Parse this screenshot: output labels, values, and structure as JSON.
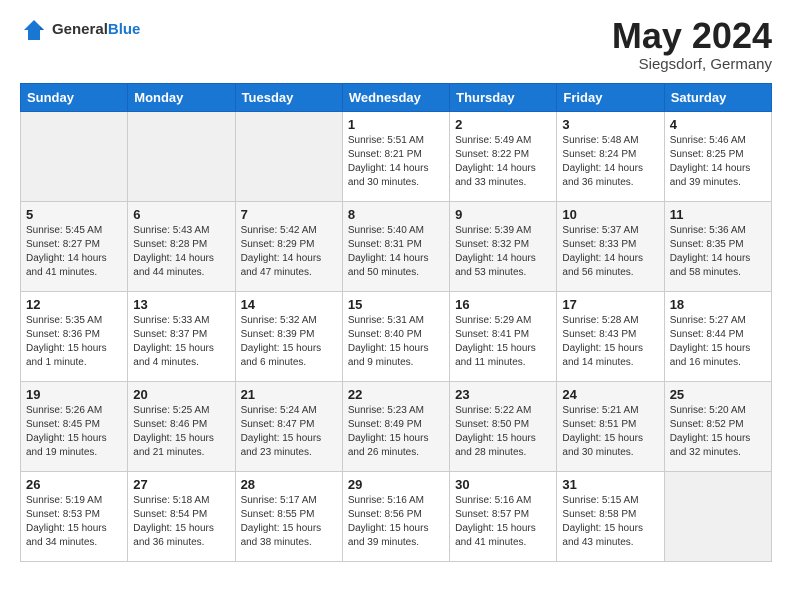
{
  "header": {
    "logo_general": "General",
    "logo_blue": "Blue",
    "month_title": "May 2024",
    "location": "Siegsdorf, Germany"
  },
  "days_of_week": [
    "Sunday",
    "Monday",
    "Tuesday",
    "Wednesday",
    "Thursday",
    "Friday",
    "Saturday"
  ],
  "weeks": [
    [
      {
        "day": "",
        "info": ""
      },
      {
        "day": "",
        "info": ""
      },
      {
        "day": "",
        "info": ""
      },
      {
        "day": "1",
        "info": "Sunrise: 5:51 AM\nSunset: 8:21 PM\nDaylight: 14 hours\nand 30 minutes."
      },
      {
        "day": "2",
        "info": "Sunrise: 5:49 AM\nSunset: 8:22 PM\nDaylight: 14 hours\nand 33 minutes."
      },
      {
        "day": "3",
        "info": "Sunrise: 5:48 AM\nSunset: 8:24 PM\nDaylight: 14 hours\nand 36 minutes."
      },
      {
        "day": "4",
        "info": "Sunrise: 5:46 AM\nSunset: 8:25 PM\nDaylight: 14 hours\nand 39 minutes."
      }
    ],
    [
      {
        "day": "5",
        "info": "Sunrise: 5:45 AM\nSunset: 8:27 PM\nDaylight: 14 hours\nand 41 minutes."
      },
      {
        "day": "6",
        "info": "Sunrise: 5:43 AM\nSunset: 8:28 PM\nDaylight: 14 hours\nand 44 minutes."
      },
      {
        "day": "7",
        "info": "Sunrise: 5:42 AM\nSunset: 8:29 PM\nDaylight: 14 hours\nand 47 minutes."
      },
      {
        "day": "8",
        "info": "Sunrise: 5:40 AM\nSunset: 8:31 PM\nDaylight: 14 hours\nand 50 minutes."
      },
      {
        "day": "9",
        "info": "Sunrise: 5:39 AM\nSunset: 8:32 PM\nDaylight: 14 hours\nand 53 minutes."
      },
      {
        "day": "10",
        "info": "Sunrise: 5:37 AM\nSunset: 8:33 PM\nDaylight: 14 hours\nand 56 minutes."
      },
      {
        "day": "11",
        "info": "Sunrise: 5:36 AM\nSunset: 8:35 PM\nDaylight: 14 hours\nand 58 minutes."
      }
    ],
    [
      {
        "day": "12",
        "info": "Sunrise: 5:35 AM\nSunset: 8:36 PM\nDaylight: 15 hours\nand 1 minute."
      },
      {
        "day": "13",
        "info": "Sunrise: 5:33 AM\nSunset: 8:37 PM\nDaylight: 15 hours\nand 4 minutes."
      },
      {
        "day": "14",
        "info": "Sunrise: 5:32 AM\nSunset: 8:39 PM\nDaylight: 15 hours\nand 6 minutes."
      },
      {
        "day": "15",
        "info": "Sunrise: 5:31 AM\nSunset: 8:40 PM\nDaylight: 15 hours\nand 9 minutes."
      },
      {
        "day": "16",
        "info": "Sunrise: 5:29 AM\nSunset: 8:41 PM\nDaylight: 15 hours\nand 11 minutes."
      },
      {
        "day": "17",
        "info": "Sunrise: 5:28 AM\nSunset: 8:43 PM\nDaylight: 15 hours\nand 14 minutes."
      },
      {
        "day": "18",
        "info": "Sunrise: 5:27 AM\nSunset: 8:44 PM\nDaylight: 15 hours\nand 16 minutes."
      }
    ],
    [
      {
        "day": "19",
        "info": "Sunrise: 5:26 AM\nSunset: 8:45 PM\nDaylight: 15 hours\nand 19 minutes."
      },
      {
        "day": "20",
        "info": "Sunrise: 5:25 AM\nSunset: 8:46 PM\nDaylight: 15 hours\nand 21 minutes."
      },
      {
        "day": "21",
        "info": "Sunrise: 5:24 AM\nSunset: 8:47 PM\nDaylight: 15 hours\nand 23 minutes."
      },
      {
        "day": "22",
        "info": "Sunrise: 5:23 AM\nSunset: 8:49 PM\nDaylight: 15 hours\nand 26 minutes."
      },
      {
        "day": "23",
        "info": "Sunrise: 5:22 AM\nSunset: 8:50 PM\nDaylight: 15 hours\nand 28 minutes."
      },
      {
        "day": "24",
        "info": "Sunrise: 5:21 AM\nSunset: 8:51 PM\nDaylight: 15 hours\nand 30 minutes."
      },
      {
        "day": "25",
        "info": "Sunrise: 5:20 AM\nSunset: 8:52 PM\nDaylight: 15 hours\nand 32 minutes."
      }
    ],
    [
      {
        "day": "26",
        "info": "Sunrise: 5:19 AM\nSunset: 8:53 PM\nDaylight: 15 hours\nand 34 minutes."
      },
      {
        "day": "27",
        "info": "Sunrise: 5:18 AM\nSunset: 8:54 PM\nDaylight: 15 hours\nand 36 minutes."
      },
      {
        "day": "28",
        "info": "Sunrise: 5:17 AM\nSunset: 8:55 PM\nDaylight: 15 hours\nand 38 minutes."
      },
      {
        "day": "29",
        "info": "Sunrise: 5:16 AM\nSunset: 8:56 PM\nDaylight: 15 hours\nand 39 minutes."
      },
      {
        "day": "30",
        "info": "Sunrise: 5:16 AM\nSunset: 8:57 PM\nDaylight: 15 hours\nand 41 minutes."
      },
      {
        "day": "31",
        "info": "Sunrise: 5:15 AM\nSunset: 8:58 PM\nDaylight: 15 hours\nand 43 minutes."
      },
      {
        "day": "",
        "info": ""
      }
    ]
  ]
}
